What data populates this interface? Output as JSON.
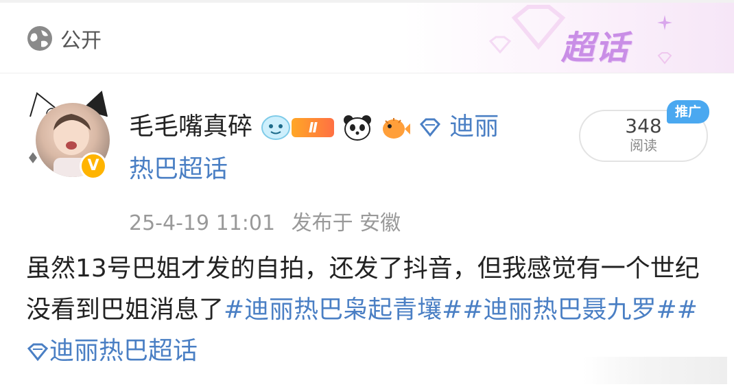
{
  "header": {
    "visibility_label": "公开",
    "supertopic_label": "超话"
  },
  "post": {
    "username": "毛毛嘴真碎",
    "level_badge": "Ⅱ",
    "topic_name_part1": "迪丽",
    "topic_name_part2": "热巴超话",
    "read_count": "348",
    "read_label": "阅读",
    "promo_label": "推广",
    "timestamp": "25-4-19 11:01",
    "location": "发布于 安徽",
    "content_text": "虽然13号巴姐才发的自拍，还发了抖音，但我感觉有一个世纪没看到巴姐消息了",
    "tags": [
      "#迪丽热巴枭起青壤#",
      "#迪丽热巴聂九罗#",
      "迪丽热巴超话"
    ]
  },
  "colors": {
    "link": "#4a7fc4",
    "supertopic": "#c98ee6",
    "verified": "#ffb400",
    "promo": "#4aa8f0"
  }
}
